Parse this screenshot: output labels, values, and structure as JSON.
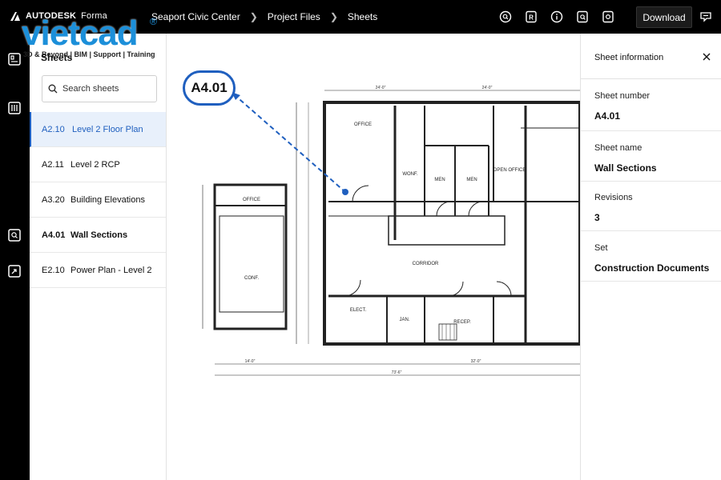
{
  "topbar": {
    "brand": "AUTODESK",
    "product": "Forma",
    "breadcrumbs": [
      "Seaport Civic Center",
      "Project Files",
      "Sheets"
    ],
    "download_label": "Download"
  },
  "watermark": {
    "word": "vietcad",
    "tagline": "3D & Beyond | BIM | Support | Training"
  },
  "sheets_panel": {
    "title": "Sheets",
    "search_placeholder": "Search sheets",
    "items": [
      {
        "number": "A2.10",
        "name": "Level 2 Floor Plan",
        "state": "selected"
      },
      {
        "number": "A2.11",
        "name": "Level 2 RCP",
        "state": "normal"
      },
      {
        "number": "A3.20",
        "name": "Building Elevations",
        "state": "normal"
      },
      {
        "number": "A4.01",
        "name": "Wall Sections",
        "state": "bold"
      },
      {
        "number": "E2.10",
        "name": "Power Plan - Level 2",
        "state": "normal"
      }
    ]
  },
  "drawing": {
    "callout_label": "A4.01",
    "room_labels": [
      "OFFICE",
      "WONF.",
      "MEN",
      "MEN",
      "OPEN OFFICE",
      "OFFICE",
      "CONF.",
      "CORRIDOR",
      "ELECT.",
      "JAN.",
      "RECEP."
    ],
    "dimensions": [
      "24'-0\"",
      "24'-0\"",
      "14'-0\"",
      "32'-0\"",
      "73'-6\""
    ]
  },
  "info_panel": {
    "title": "Sheet information",
    "fields": [
      {
        "label": "Sheet number",
        "value": "A4.01"
      },
      {
        "label": "Sheet name",
        "value": "Wall Sections"
      },
      {
        "label": "Revisions",
        "value": "3"
      },
      {
        "label": "Set",
        "value": "Construction Documents"
      }
    ]
  },
  "colors": {
    "accent": "#1f5fbf",
    "selected_bg": "#e8f0fb",
    "topbar_bg": "#000000",
    "watermark": "#1c8fd9"
  },
  "icons": {
    "topbar": [
      "search-doc-icon",
      "r-badge-icon",
      "info-icon",
      "markup-icon",
      "lock-icon"
    ],
    "rail": [
      "sheets-icon",
      "files-icon",
      "search-doc-icon",
      "export-icon"
    ]
  }
}
